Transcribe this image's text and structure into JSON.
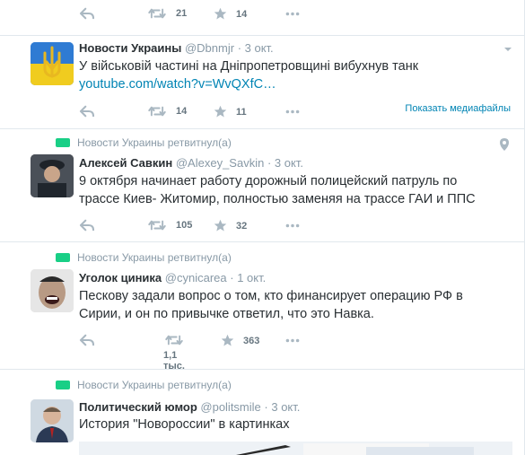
{
  "tweets": [
    {
      "actions": {
        "retweets": "21",
        "likes": "14"
      }
    },
    {
      "author": "Новости Украины",
      "handle": "@Dbnmjr",
      "time": "· 3 окт.",
      "text": "У військовій частині на Дніпропетровщині вибухнув танк",
      "link": "youtube.com/watch?v=WvQXfC…",
      "actions": {
        "retweets": "14",
        "likes": "11"
      },
      "media_link": "Показать медиафайлы"
    },
    {
      "context": "Новости Украины ретвитнул(а)",
      "author": "Алексей Савкин",
      "handle": "@Alexey_Savkin",
      "time": "· 3 окт.",
      "text": "9 октября начинает работу дорожный полицейский патруль по трассе Киев- Житомир, полностью заменяя на трассе ГАИ и ППС",
      "actions": {
        "retweets": "105",
        "likes": "32"
      }
    },
    {
      "context": "Новости Украины ретвитнул(а)",
      "author": "Уголок циника",
      "handle": "@cynicarea",
      "time": "· 1 окт.",
      "text": "Пескову задали вопрос о том, кто финансирует операцию РФ в Сирии, и он по привычке ответил, что это Навка.",
      "actions": {
        "retweets": "1,1 тыс.",
        "likes": "363"
      }
    },
    {
      "context": "Новости Украины ретвитнул(а)",
      "author": "Политический юмор",
      "handle": "@politsmile",
      "time": "· 3 окт.",
      "text": "История \"Новороссии\" в картинках"
    }
  ],
  "colors": {
    "link": "#0084b4",
    "retweet_green": "#19cf86",
    "muted": "#8899a6"
  }
}
